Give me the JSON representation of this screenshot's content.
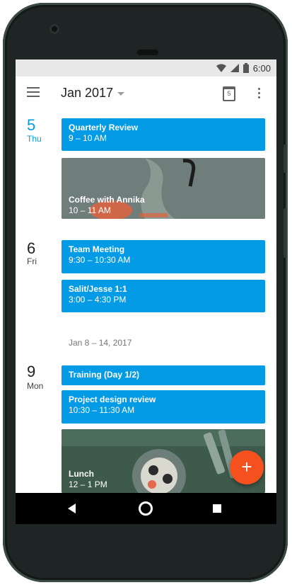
{
  "status_bar": {
    "time": "6:00"
  },
  "app_bar": {
    "month": "Jan 2017",
    "today_date": "5"
  },
  "days": [
    {
      "number": "5",
      "weekday": "Thu"
    },
    {
      "number": "6",
      "weekday": "Fri"
    },
    {
      "number": "9",
      "weekday": "Mon"
    }
  ],
  "week_range": "Jan 8 – 14, 2017",
  "events": [
    {
      "title": "Quarterly Review",
      "time": "9 – 10 AM"
    },
    {
      "title": "Coffee with Annika",
      "time": "10 – 11 AM"
    },
    {
      "title": "Team Meeting",
      "time": "9:30 – 10:30 AM"
    },
    {
      "title": "Salit/Jesse 1:1",
      "time": "3:00 – 4:30 PM"
    },
    {
      "title": "Training (Day 1/2)"
    },
    {
      "title": "Project design review",
      "time": "10:30 – 11:30 AM"
    },
    {
      "title": "Lunch",
      "time": "12 – 1 PM"
    }
  ],
  "fab": {
    "label": "+"
  },
  "colors": {
    "event": "#039be5",
    "today": "#039be5",
    "fab": "#f4511e"
  },
  "icons": [
    "menu-icon",
    "dropdown-icon",
    "today-icon",
    "more-vert-icon",
    "wifi-icon",
    "signal-icon",
    "battery-icon",
    "back-icon",
    "home-icon",
    "recents-icon",
    "add-icon"
  ]
}
